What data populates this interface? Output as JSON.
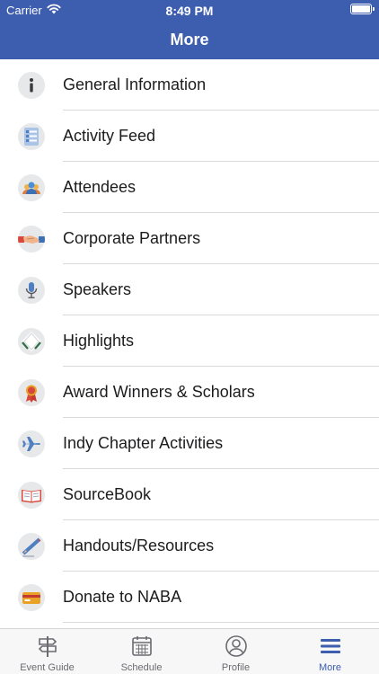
{
  "status_bar": {
    "carrier": "Carrier",
    "time": "8:49 PM"
  },
  "header": {
    "title": "More"
  },
  "menu": [
    {
      "label": "General Information",
      "icon": "info-icon"
    },
    {
      "label": "Activity Feed",
      "icon": "activity-feed-icon"
    },
    {
      "label": "Attendees",
      "icon": "attendees-icon"
    },
    {
      "label": "Corporate Partners",
      "icon": "handshake-icon"
    },
    {
      "label": "Speakers",
      "icon": "microphone-icon"
    },
    {
      "label": "Highlights",
      "icon": "highlights-icon"
    },
    {
      "label": "Award Winners & Scholars",
      "icon": "award-ribbon-icon"
    },
    {
      "label": "Indy Chapter Activities",
      "icon": "airplane-icon"
    },
    {
      "label": "SourceBook",
      "icon": "open-book-icon"
    },
    {
      "label": "Handouts/Resources",
      "icon": "pencil-note-icon"
    },
    {
      "label": "Donate to NABA",
      "icon": "credit-card-icon"
    }
  ],
  "tabbar": {
    "tabs": [
      {
        "label": "Event Guide",
        "icon": "signpost-icon"
      },
      {
        "label": "Schedule",
        "icon": "calendar-icon"
      },
      {
        "label": "Profile",
        "icon": "profile-icon"
      },
      {
        "label": "More",
        "icon": "hamburger-menu-icon"
      }
    ],
    "active": "More"
  },
  "colors": {
    "header": "#3d5daf",
    "accent": "#3d5daf",
    "tab_inactive": "#6b6b70"
  }
}
